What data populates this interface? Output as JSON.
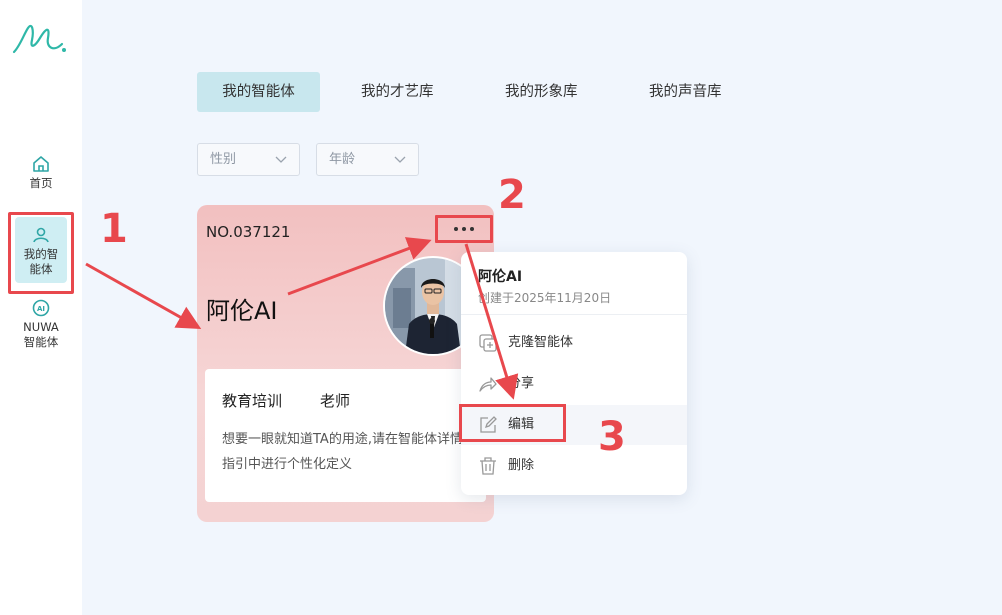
{
  "sidebar": {
    "items": [
      {
        "label": "首页",
        "icon": "home-icon"
      },
      {
        "label": "我的智能体",
        "icon": "user-icon",
        "active": true
      },
      {
        "label_line1": "NUWA",
        "label_line2": "智能体",
        "icon": "ai-icon"
      }
    ]
  },
  "tabs": [
    {
      "label": "我的智能体",
      "active": true
    },
    {
      "label": "我的才艺库"
    },
    {
      "label": "我的形象库"
    },
    {
      "label": "我的声音库"
    }
  ],
  "filters": [
    {
      "placeholder": "性别"
    },
    {
      "placeholder": "年龄"
    }
  ],
  "card": {
    "number": "NO.037121",
    "name": "阿伦AI",
    "tag_industry": "教育培训",
    "tag_role": "老师",
    "description": "想要一眼就知道TA的用途,请在智能体详情指引中进行个性化定义"
  },
  "menu": {
    "title": "阿伦AI",
    "created": "创建于2025年11月20日",
    "items": [
      {
        "label": "克隆智能体",
        "icon": "clone-icon"
      },
      {
        "label": "分享",
        "icon": "share-icon"
      },
      {
        "label": "编辑",
        "icon": "edit-icon",
        "hovered": true
      },
      {
        "label": "删除",
        "icon": "trash-icon"
      }
    ]
  },
  "annotations": {
    "step1": "1",
    "step2": "2",
    "step3": "3",
    "color": "#e8484d"
  },
  "colors": {
    "accent": "#c8e7ee",
    "sidebar_active": "#cfeef3",
    "logo": "#2fb8a8"
  }
}
